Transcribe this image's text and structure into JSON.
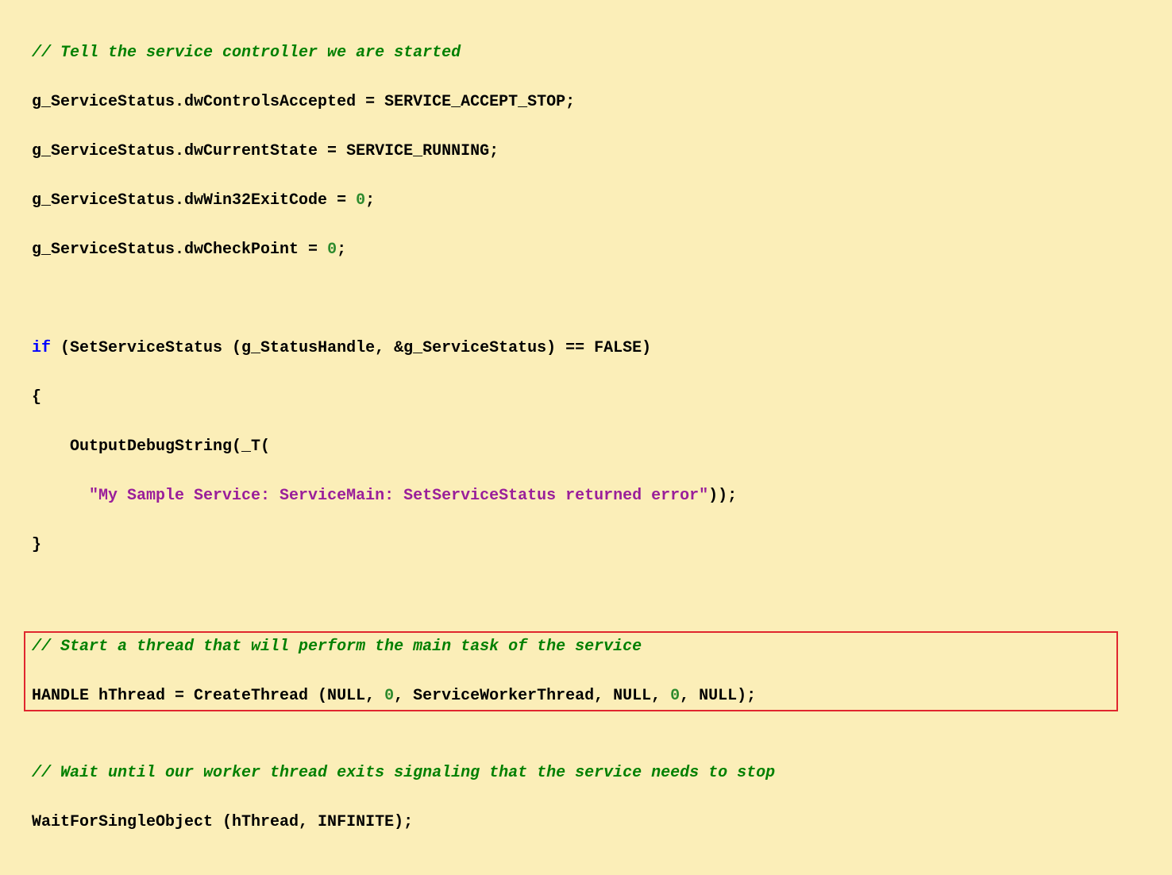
{
  "code": {
    "comment1": "// Tell the service controller we are started",
    "line1a": "g_ServiceStatus.dwControlsAccepted = SERVICE_ACCEPT_STOP;",
    "line1b": "g_ServiceStatus.dwCurrentState = SERVICE_RUNNING;",
    "line1c_pre": "g_ServiceStatus.dwWin32ExitCode = ",
    "line1c_num": "0",
    "line1c_post": ";",
    "line1d_pre": "g_ServiceStatus.dwCheckPoint = ",
    "line1d_num": "0",
    "line1d_post": ";",
    "if_kw": "if",
    "if_cond": " (SetServiceStatus (g_StatusHandle, &g_ServiceStatus) == FALSE)",
    "brace_open": "{",
    "ods_call": "    OutputDebugString(_T(",
    "ods_indent": "      ",
    "ods_string": "\"My Sample Service: ServiceMain: SetServiceStatus returned error\"",
    "ods_end": "));",
    "brace_close": "}",
    "comment2": "// Start a thread that will perform the main task of the service",
    "ct_pre": "HANDLE hThread = CreateThread (NULL, ",
    "ct_n1": "0",
    "ct_mid": ", ServiceWorkerThread, NULL, ",
    "ct_n2": "0",
    "ct_post": ", NULL);",
    "comment3": "// Wait until our worker thread exits signaling that the service needs to stop",
    "wfso": "WaitForSingleObject (hThread, INFINITE);"
  }
}
